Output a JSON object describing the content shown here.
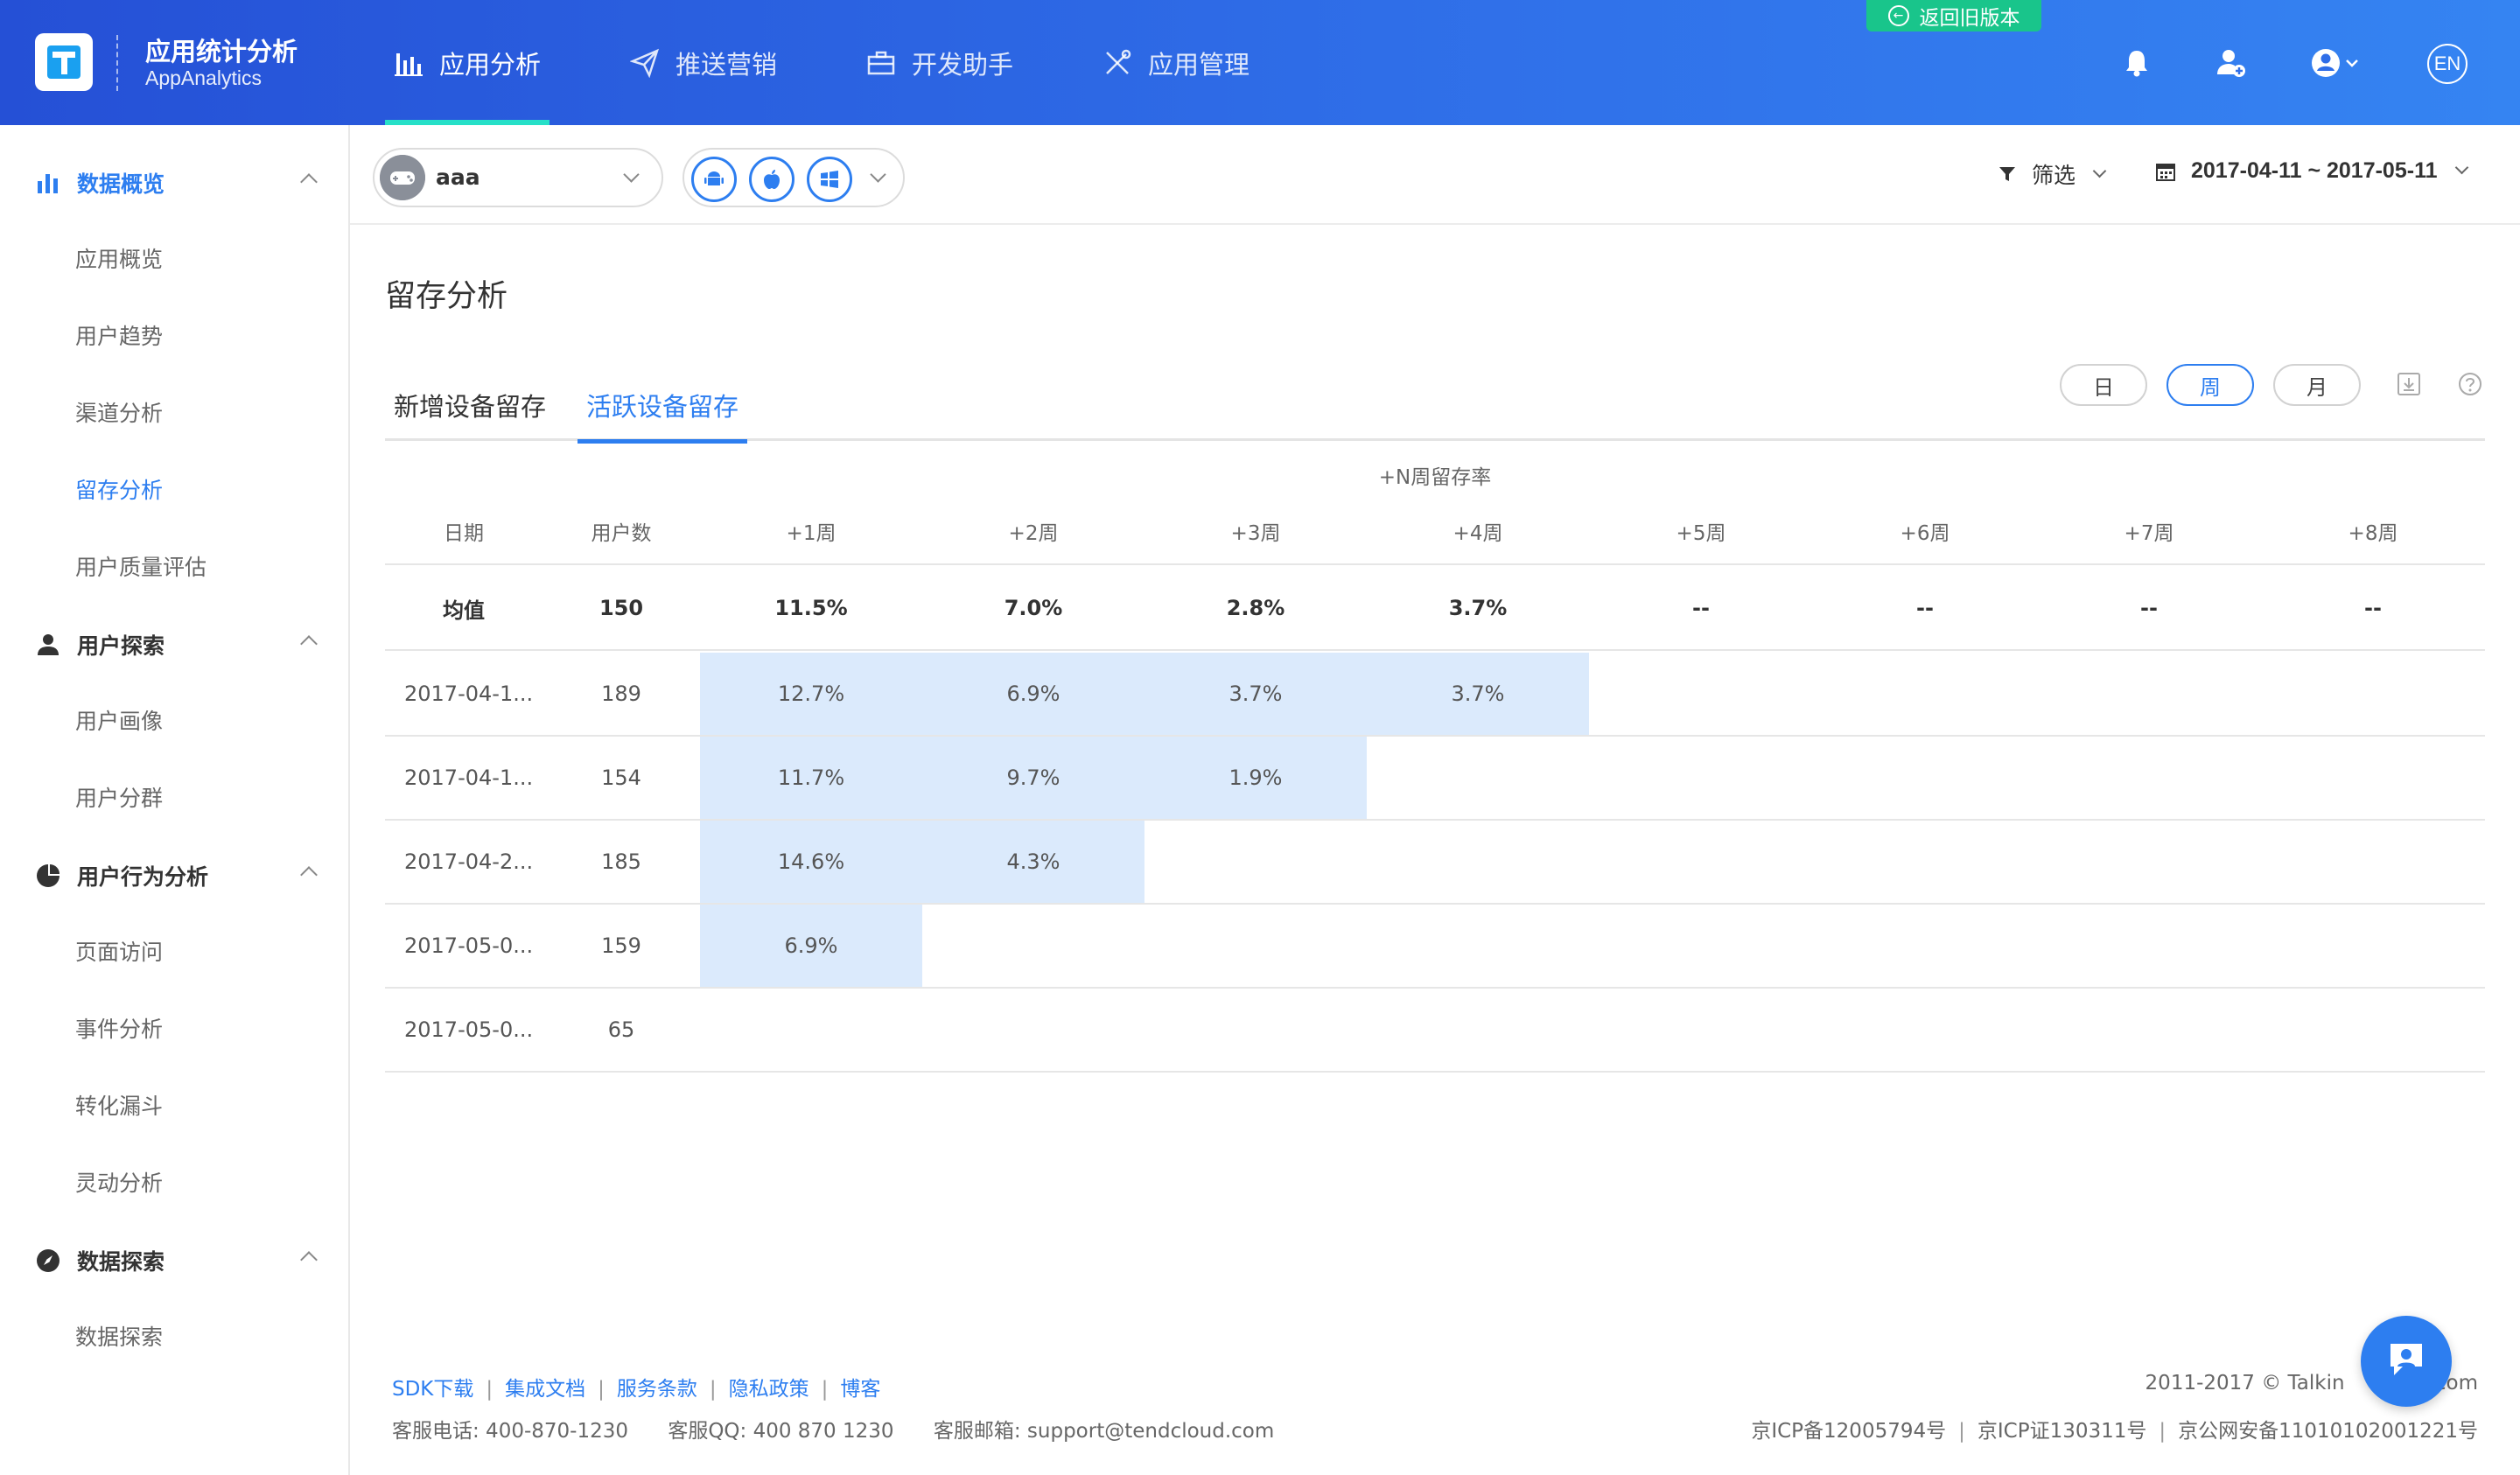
{
  "header": {
    "brand_cn": "应用统计分析",
    "brand_en": "AppAnalytics",
    "old_version": "返回旧版本",
    "lang": "EN",
    "nav": [
      {
        "label": "应用分析",
        "icon": "bar-chart-icon",
        "active": true
      },
      {
        "label": "推送营销",
        "icon": "paper-plane-icon",
        "active": false
      },
      {
        "label": "开发助手",
        "icon": "toolbox-icon",
        "active": false
      },
      {
        "label": "应用管理",
        "icon": "tools-icon",
        "active": false
      }
    ]
  },
  "sidebar": {
    "groups": [
      {
        "label": "数据概览",
        "icon": "bar-chart-icon",
        "items": [
          "应用概览",
          "用户趋势",
          "渠道分析",
          "留存分析",
          "用户质量评估"
        ]
      },
      {
        "label": "用户探索",
        "icon": "user-icon",
        "items": [
          "用户画像",
          "用户分群"
        ]
      },
      {
        "label": "用户行为分析",
        "icon": "pie-chart-icon",
        "items": [
          "页面访问",
          "事件分析",
          "转化漏斗",
          "灵动分析"
        ]
      },
      {
        "label": "数据探索",
        "icon": "compass-icon",
        "items": [
          "数据探索"
        ]
      }
    ],
    "active_item": "留存分析"
  },
  "filterbar": {
    "app_name": "aaa",
    "platforms": [
      "android-icon",
      "apple-icon",
      "windows-icon"
    ],
    "filter_label": "筛选",
    "date_range": "2017-04-11 ~ 2017-05-11"
  },
  "main": {
    "title": "留存分析",
    "tabs": [
      {
        "label": "新增设备留存",
        "active": false
      },
      {
        "label": "活跃设备留存",
        "active": true
      }
    ],
    "periods": [
      {
        "label": "日",
        "active": false
      },
      {
        "label": "周",
        "active": true
      },
      {
        "label": "月",
        "active": false
      }
    ]
  },
  "table": {
    "super_header": "+N周留存率",
    "columns": [
      "日期",
      "用户数",
      "+1周",
      "+2周",
      "+3周",
      "+4周",
      "+5周",
      "+6周",
      "+7周",
      "+8周"
    ],
    "average": [
      "均值",
      "150",
      "11.5%",
      "7.0%",
      "2.8%",
      "3.7%",
      "--",
      "--",
      "--",
      "--"
    ],
    "rows": [
      [
        "2017-04-1...",
        "189",
        "12.7%",
        "6.9%",
        "3.7%",
        "3.7%",
        "",
        "",
        "",
        ""
      ],
      [
        "2017-04-1...",
        "154",
        "11.7%",
        "9.7%",
        "1.9%",
        "",
        "",
        "",
        "",
        ""
      ],
      [
        "2017-04-2...",
        "185",
        "14.6%",
        "4.3%",
        "",
        "",
        "",
        "",
        "",
        ""
      ],
      [
        "2017-05-0...",
        "159",
        "6.9%",
        "",
        "",
        "",
        "",
        "",
        "",
        ""
      ],
      [
        "2017-05-0...",
        "65",
        "",
        "",
        "",
        "",
        "",
        "",
        "",
        ""
      ]
    ]
  },
  "footer": {
    "links": [
      "SDK下载",
      "集成文档",
      "服务条款",
      "隐私政策",
      "博客"
    ],
    "contact": [
      "客服电话: 400-870-1230",
      "客服QQ: 400 870 1230",
      "客服邮箱: support@tendcloud.com"
    ],
    "copyright": "2011-2017 © Talkin",
    "copyright_tail": ".com",
    "icp": [
      "京ICP备12005794号",
      "京ICP证130311号",
      "京公网安备11010102001221号"
    ]
  },
  "colors": {
    "accent": "#2d7ef0",
    "header_start": "#2550d6",
    "header_end": "#3584f2",
    "tab_indicator": "#26e0c8",
    "cell_fill": "#dbeafc",
    "old_version_bg": "#19c58b"
  }
}
